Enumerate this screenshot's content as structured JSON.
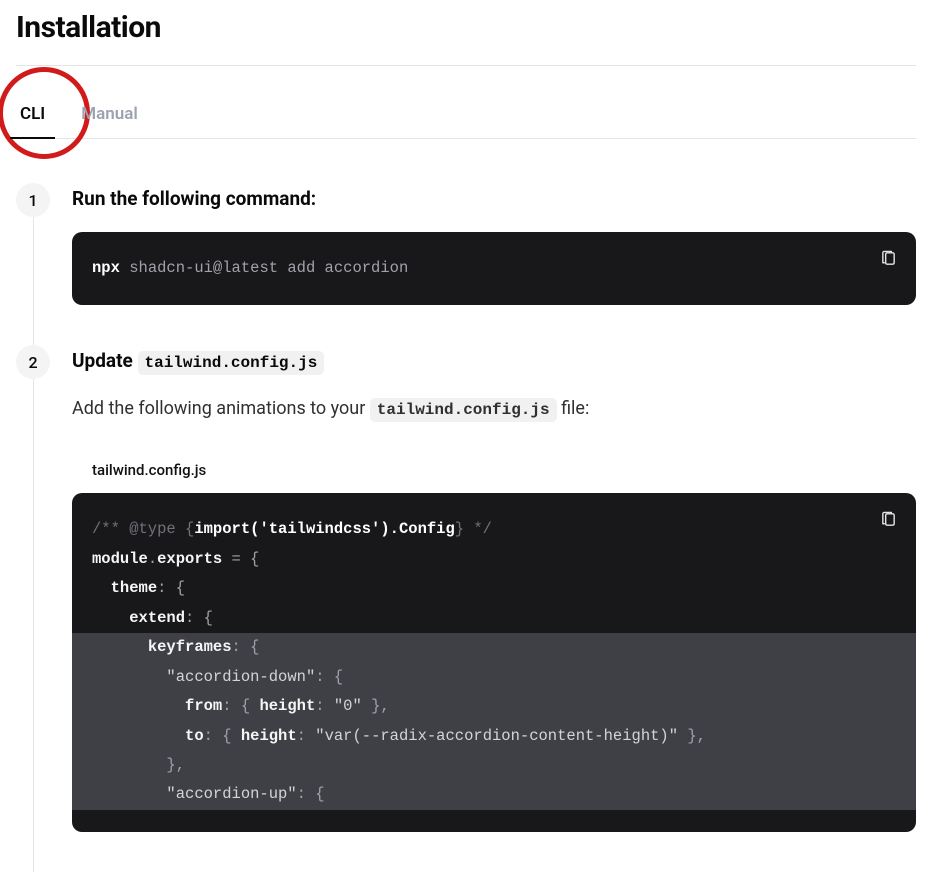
{
  "title": "Installation",
  "tabs": [
    {
      "label": "CLI",
      "active": true
    },
    {
      "label": "Manual",
      "active": false
    }
  ],
  "annotation": {
    "circle_on_tab": "CLI"
  },
  "steps": [
    {
      "number": "1",
      "title": "Run the following command:",
      "command": {
        "prefix": "npx",
        "rest": "shadcn-ui@latest add accordion"
      }
    },
    {
      "number": "2",
      "title_prefix": "Update ",
      "title_code": "tailwind.config.js",
      "description_prefix": "Add the following animations to your ",
      "description_code": "tailwind.config.js",
      "description_suffix": " file:",
      "file_tab": "tailwind.config.js",
      "code_lines": [
        {
          "hl": false,
          "tokens": [
            {
              "c": "com",
              "t": "/** @type {"
            },
            {
              "c": "imp",
              "t": "import('tailwindcss').Config"
            },
            {
              "c": "com",
              "t": "} */"
            }
          ]
        },
        {
          "hl": false,
          "tokens": [
            {
              "c": "obj",
              "t": "module"
            },
            {
              "c": "pn",
              "t": "."
            },
            {
              "c": "obj",
              "t": "exports"
            },
            {
              "c": "pn",
              "t": " = {"
            }
          ]
        },
        {
          "hl": false,
          "tokens": [
            {
              "c": "pn",
              "t": "  "
            },
            {
              "c": "key",
              "t": "theme"
            },
            {
              "c": "pn",
              "t": ": {"
            }
          ]
        },
        {
          "hl": false,
          "tokens": [
            {
              "c": "pn",
              "t": "    "
            },
            {
              "c": "key",
              "t": "extend"
            },
            {
              "c": "pn",
              "t": ": {"
            }
          ]
        },
        {
          "hl": true,
          "tokens": [
            {
              "c": "pn",
              "t": "      "
            },
            {
              "c": "key",
              "t": "keyframes"
            },
            {
              "c": "pn",
              "t": ": {"
            }
          ]
        },
        {
          "hl": true,
          "tokens": [
            {
              "c": "pn",
              "t": "        "
            },
            {
              "c": "str",
              "t": "\"accordion-down\""
            },
            {
              "c": "pn",
              "t": ": {"
            }
          ]
        },
        {
          "hl": true,
          "tokens": [
            {
              "c": "pn",
              "t": "          "
            },
            {
              "c": "key",
              "t": "from"
            },
            {
              "c": "pn",
              "t": ": { "
            },
            {
              "c": "key",
              "t": "height"
            },
            {
              "c": "pn",
              "t": ": "
            },
            {
              "c": "str",
              "t": "\"0\""
            },
            {
              "c": "pn",
              "t": " },"
            }
          ]
        },
        {
          "hl": true,
          "tokens": [
            {
              "c": "pn",
              "t": "          "
            },
            {
              "c": "key",
              "t": "to"
            },
            {
              "c": "pn",
              "t": ": { "
            },
            {
              "c": "key",
              "t": "height"
            },
            {
              "c": "pn",
              "t": ": "
            },
            {
              "c": "str",
              "t": "\"var(--radix-accordion-content-height)\""
            },
            {
              "c": "pn",
              "t": " },"
            }
          ]
        },
        {
          "hl": true,
          "tokens": [
            {
              "c": "pn",
              "t": "        },"
            }
          ]
        },
        {
          "hl": true,
          "tokens": [
            {
              "c": "pn",
              "t": "        "
            },
            {
              "c": "str",
              "t": "\"accordion-up\""
            },
            {
              "c": "pn",
              "t": ": {"
            }
          ]
        }
      ]
    }
  ],
  "icons": {
    "copy": "clipboard-icon"
  }
}
